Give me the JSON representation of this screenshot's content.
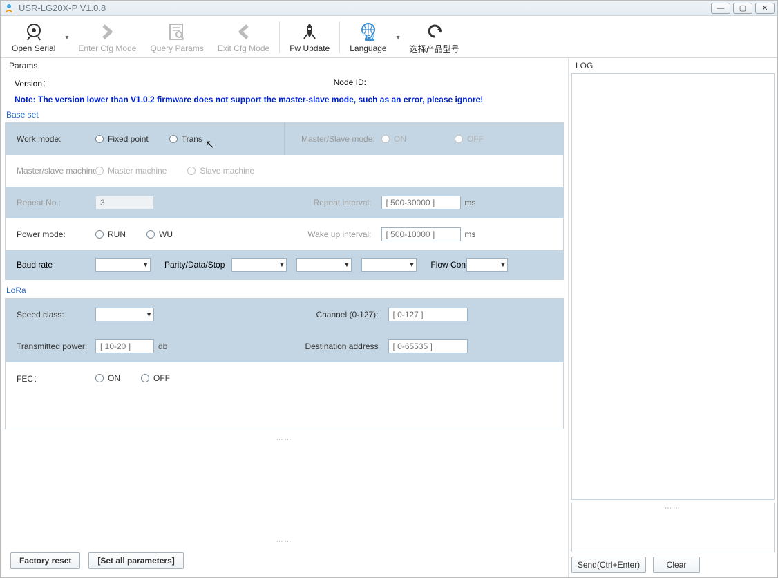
{
  "window": {
    "title": "USR-LG20X-P  V1.0.8"
  },
  "toolbar": {
    "open_serial": "Open Serial",
    "enter_cfg": "Enter Cfg Mode",
    "query_params": "Query Params",
    "exit_cfg": "Exit Cfg Mode",
    "fw_update": "Fw Update",
    "language": "Language",
    "product": "选择产品型号"
  },
  "panels": {
    "params": "Params",
    "log": "LOG"
  },
  "info": {
    "version_label": "Version：",
    "version_value": "",
    "nodeid_label": "Node ID:",
    "nodeid_value": "",
    "note": "Note: The version lower than V1.0.2 firmware does not support the master-slave mode, such as an error, please ignore!"
  },
  "sections": {
    "base_set": "Base set",
    "lora": "LoRa"
  },
  "base": {
    "work_mode_label": "Work mode:",
    "fixed_point": "Fixed point",
    "trans": "Trans",
    "ms_mode_label": "Master/Slave mode:",
    "on": "ON",
    "off": "OFF",
    "ms_machine_label": "Master/slave machine",
    "master_machine": "Master machine",
    "slave_machine": "Slave machine",
    "repeat_no_label": "Repeat No.:",
    "repeat_no_value": "3",
    "repeat_interval_label": "Repeat interval:",
    "repeat_interval_ph": "[ 500-30000 ]",
    "ms": "ms",
    "power_mode_label": "Power mode:",
    "run": "RUN",
    "wu": "WU",
    "wake_interval_label": "Wake up interval:",
    "wake_interval_ph": "[ 500-10000 ]",
    "baud_label": "Baud rate",
    "parity_label": "Parity/Data/Stop",
    "flow_label": "Flow Control"
  },
  "lora": {
    "speed_label": "Speed class:",
    "channel_label": "Channel (0-127):",
    "channel_ph": "[ 0-127 ]",
    "txpower_label": "Transmitted power:",
    "txpower_ph": "[ 10-20 ]",
    "db": "db",
    "dest_label": "Destination address",
    "dest_ph": "[ 0-65535 ]",
    "fec_label": "FEC：",
    "on": "ON",
    "off": "OFF"
  },
  "footer": {
    "factory_reset": "Factory reset",
    "set_all": "[Set all parameters]"
  },
  "right": {
    "send": "Send(Ctrl+Enter)",
    "clear": "Clear"
  }
}
